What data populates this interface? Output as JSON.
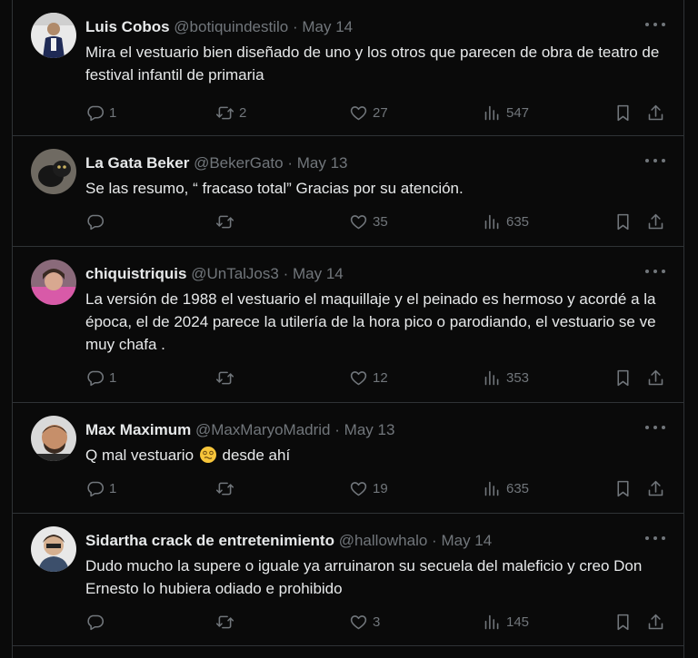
{
  "tweets": [
    {
      "name": "Luis Cobos",
      "handle": "@botiquindestilo",
      "sep": "·",
      "date": "May 14",
      "text": "Mira el vestuario bien diseñado de uno y los otros que parecen de obra de teatro de festival infantil de primaria",
      "replies": "1",
      "retweets": "2",
      "likes": "27",
      "views": "547"
    },
    {
      "name": "La Gata Beker",
      "handle": "@BekerGato",
      "sep": "·",
      "date": "May 13",
      "text": "Se las resumo, “ fracaso total” Gracias por su atención.",
      "replies": "",
      "retweets": "",
      "likes": "35",
      "views": "635"
    },
    {
      "name": "chiquistriquis",
      "handle": "@UnTalJos3",
      "sep": "·",
      "date": "May 14",
      "text": "La versión de 1988 el vestuario el maquillaje y el peinado es hermoso y acordé a la época, el de 2024 parece la utilería de la hora pico o parodiando, el vestuario se ve muy chafa .",
      "replies": "1",
      "retweets": "",
      "likes": "12",
      "views": "353"
    },
    {
      "name": "Max Maximum",
      "handle": "@MaxMaryoMadrid",
      "sep": "·",
      "date": "May 13",
      "text_before": "Q mal vestuario ",
      "emoji": "woozy-face-emoji",
      "text_after": " desde ahí",
      "replies": "1",
      "retweets": "",
      "likes": "19",
      "views": "635"
    },
    {
      "name": "Sidartha crack de entretenimiento",
      "handle": "@hallowhalo",
      "sep": "·",
      "date": "May 14",
      "text": "Dudo mucho la supere o iguale ya arruinaron su secuela del maleficio y creo Don Ernesto lo hubiera odiado e prohibido",
      "replies": "",
      "retweets": "",
      "likes": "3",
      "views": "145"
    }
  ],
  "colors": {
    "background": "#0a0a0a",
    "border": "#2f3336",
    "text": "#e7e9ea",
    "muted": "#71767b"
  }
}
